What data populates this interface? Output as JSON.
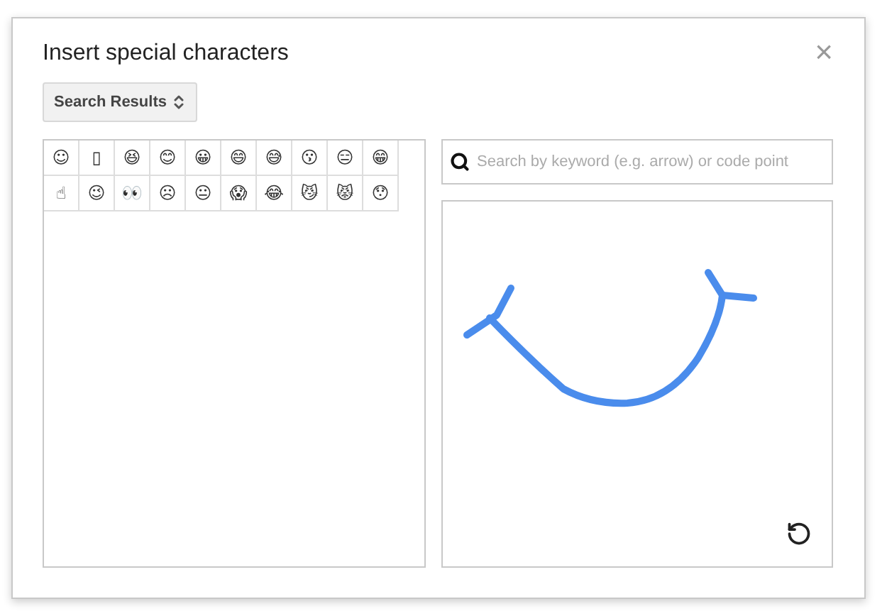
{
  "dialog": {
    "title": "Insert special characters",
    "close": "×"
  },
  "category": {
    "label": "Search Results"
  },
  "characters": [
    "☺",
    "▯",
    "😆",
    "😊",
    "😀",
    "😄",
    "😅",
    "😗",
    "😑",
    "😁",
    "☝",
    "😉",
    "👀",
    "☹",
    "😐",
    "😱",
    "😂",
    "😼",
    "😾",
    "😯"
  ],
  "search": {
    "placeholder": "Search by keyword (e.g. arrow) or code point"
  }
}
